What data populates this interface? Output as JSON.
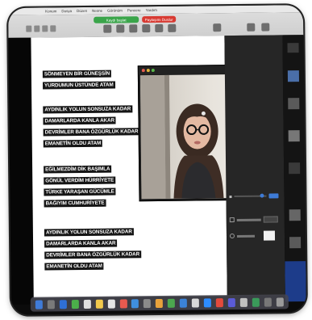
{
  "menu": {
    "items": [
      "Konum",
      "Dosya",
      "Düzen",
      "Nesne",
      "Görünüm",
      "Pencere",
      "Yardım"
    ]
  },
  "toolbar": {
    "recording_label": "Kaydı başlat",
    "stop_label": "Paylaşımı Durdur"
  },
  "poem": {
    "stanzas": [
      [
        "SÖNMEYEN BİR GÜNEŞSİN",
        "YURDUMUN ÜSTÜNDE ATAM"
      ],
      [
        "AYDINLIK YOLUN SONSUZA KADAR",
        "DAMARLARDA KANLA AKAR",
        "DEVRİMLER BANA ÖZGÜRLÜK KADAR",
        "EMANETİN OLDU ATAM"
      ],
      [
        "EĞİLMEZDİM DİK BAŞIMLA",
        "GÖNÜL VERDİM HÜRRİYETE",
        "TÜRKE YARAŞAN GÜCÜMLE",
        "BAĞIYIM CUMHURİYETE"
      ],
      [
        "AYDINLIK YOLUN SONSUZA KADAR",
        "DAMARLARDA KANLA AKAR",
        "DEVRİMLER BANA ÖZGÜRLÜK KADAR",
        "EMANETİN OLDU ATAM"
      ]
    ]
  },
  "colors": {
    "recording_green": "#3aa54a",
    "stop_red": "#d83a32",
    "doc_background": "#ffffff",
    "highlight": "#151515"
  }
}
